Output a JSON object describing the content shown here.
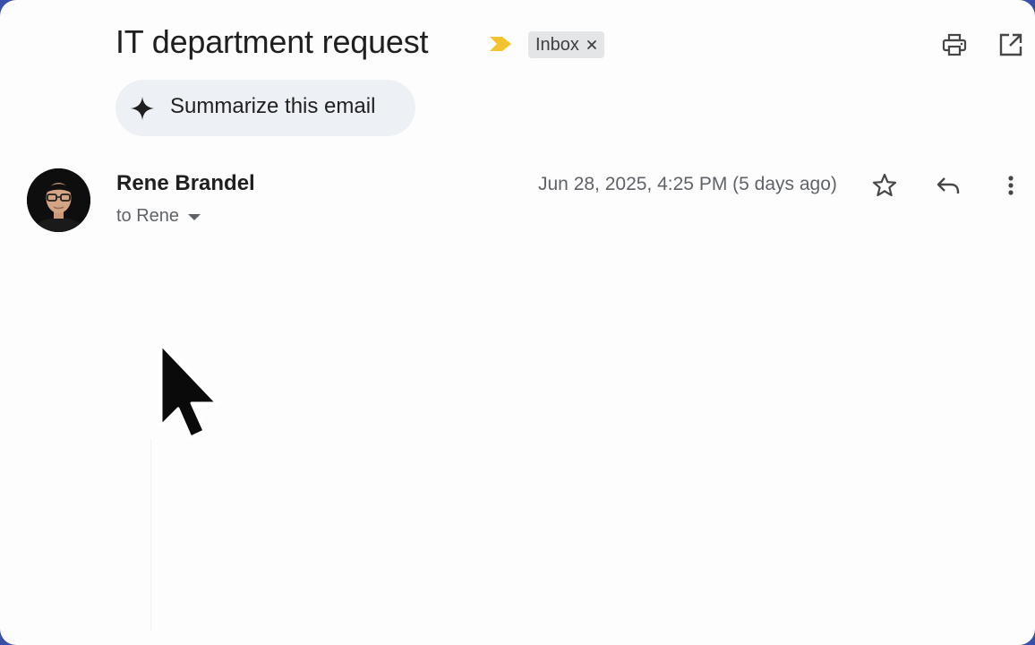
{
  "email": {
    "subject": "IT department request",
    "label_chip": "Inbox",
    "summarize_label": "Summarize this email",
    "sender_name": "Rene Brandel",
    "recipient": "to Rene",
    "date": "Jun 28, 2025, 4:25 PM (5 days ago)"
  },
  "icons": {
    "importance": "importance-marker-icon",
    "label_remove": "close-icon",
    "print": "print-icon",
    "open_new_window": "open-in-new-window-icon",
    "summarize": "sparkle-icon",
    "recipient_details": "caret-down-icon",
    "star": "star-icon",
    "reply": "reply-icon",
    "more": "more-vertical-icon",
    "cursor": "mouse-pointer-icon"
  },
  "colors": {
    "importance": "#f4c430",
    "chip_background": "#e4e5e7",
    "summarize_background": "#edf1f5",
    "text_primary": "#1f1f1f",
    "text_secondary": "#5f6368"
  }
}
